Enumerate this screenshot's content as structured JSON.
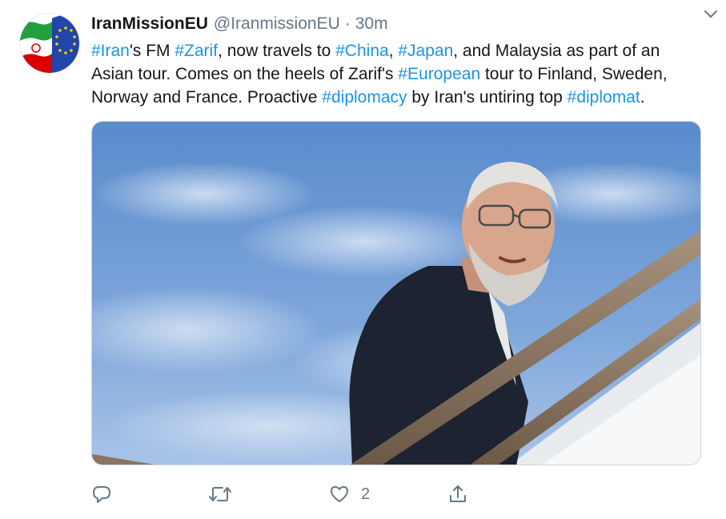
{
  "tweet": {
    "author": {
      "display_name": "IranMissionEU",
      "handle": "@IranmissionEU",
      "separator": "·",
      "time": "30m",
      "avatar_icon": "iran-eu-flags-avatar"
    },
    "text": {
      "line1": [
        {
          "t": "#Iran",
          "tag": true
        },
        {
          "t": "'s FM ",
          "tag": false
        },
        {
          "t": "#Zarif",
          "tag": true
        },
        {
          "t": ", now travels to ",
          "tag": false
        },
        {
          "t": "#China",
          "tag": true
        },
        {
          "t": ", ",
          "tag": false
        },
        {
          "t": "#Japan",
          "tag": true
        },
        {
          "t": ", and Malaysia as part of an",
          "tag": false
        }
      ],
      "line2": [
        {
          "t": "Asian tour. Comes on the heels of Zarif's ",
          "tag": false
        },
        {
          "t": "#European",
          "tag": true
        },
        {
          "t": " tour to Finland, Sweden,",
          "tag": false
        }
      ],
      "line3": [
        {
          "t": "Norway and France. Proactive ",
          "tag": false
        },
        {
          "t": "#diplomacy",
          "tag": true
        },
        {
          "t": " by Iran's untiring top ",
          "tag": false
        },
        {
          "t": "#diplomat",
          "tag": true
        },
        {
          "t": ".",
          "tag": false
        }
      ]
    },
    "media": {
      "icon": "photo-man-boarding-plane"
    },
    "actions": {
      "reply_icon": "reply-icon",
      "retweet_icon": "retweet-icon",
      "like_icon": "heart-icon",
      "like_count": "2",
      "share_icon": "share-icon",
      "menu_icon": "chevron-down-icon"
    },
    "colors": {
      "hashtag": "#1b95e0",
      "secondary": "#657786",
      "text": "#14171a"
    }
  }
}
